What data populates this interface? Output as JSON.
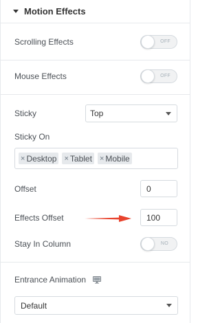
{
  "section": {
    "title": "Motion Effects"
  },
  "scrolling_effects": {
    "label": "Scrolling Effects",
    "toggle_text": "OFF"
  },
  "mouse_effects": {
    "label": "Mouse Effects",
    "toggle_text": "OFF"
  },
  "sticky": {
    "label": "Sticky",
    "value": "Top"
  },
  "sticky_on": {
    "label": "Sticky On",
    "tags": [
      "Desktop",
      "Tablet",
      "Mobile"
    ],
    "remove_glyph": "×"
  },
  "offset": {
    "label": "Offset",
    "value": "0"
  },
  "effects_offset": {
    "label": "Effects Offset",
    "value": "100"
  },
  "stay_in_column": {
    "label": "Stay In Column",
    "toggle_text": "NO"
  },
  "entrance_animation": {
    "label": "Entrance Animation",
    "value": "Default",
    "icon": "desktop-monitor-icon"
  },
  "colors": {
    "arrow": "#e8432d",
    "border": "#d5dadf"
  }
}
